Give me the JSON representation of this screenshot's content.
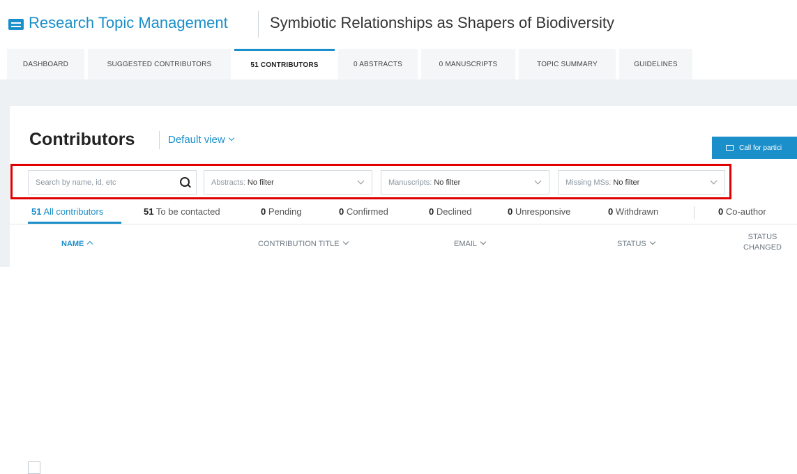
{
  "header": {
    "app_title": "Research Topic Management",
    "topic_title": "Symbiotic Relationships as Shapers of Biodiversity"
  },
  "tabs": [
    {
      "label": "DASHBOARD",
      "active": false
    },
    {
      "label": "SUGGESTED CONTRIBUTORS",
      "active": false
    },
    {
      "label": "51 CONTRIBUTORS",
      "active": true
    },
    {
      "label": "0 ABSTRACTS",
      "active": false
    },
    {
      "label": "0 MANUSCRIPTS",
      "active": false
    },
    {
      "label": "TOPIC SUMMARY",
      "active": false
    },
    {
      "label": "GUIDELINES",
      "active": false
    }
  ],
  "contributors": {
    "title": "Contributors",
    "view_select": "Default view",
    "call_button": "Call for partici"
  },
  "filters": {
    "search_placeholder": "Search by name, id, etc",
    "abstracts": {
      "label": "Abstracts:",
      "value": "No filter"
    },
    "manuscripts": {
      "label": "Manuscripts:",
      "value": "No filter"
    },
    "missing_ms": {
      "label": "Missing MSs:",
      "value": "No filter"
    }
  },
  "status_tabs": [
    {
      "count": "51",
      "label": "All contributors"
    },
    {
      "count": "51",
      "label": "To be contacted"
    },
    {
      "count": "0",
      "label": "Pending"
    },
    {
      "count": "0",
      "label": "Confirmed"
    },
    {
      "count": "0",
      "label": "Declined"
    },
    {
      "count": "0",
      "label": "Unresponsive"
    },
    {
      "count": "0",
      "label": "Withdrawn"
    },
    {
      "count": "0",
      "label": "Co-author"
    }
  ],
  "table": {
    "columns": {
      "name": "NAME",
      "contribution_title": "CONTRIBUTION TITLE",
      "email": "EMAIL",
      "status": "STATUS",
      "status_changed_line1": "STATUS",
      "status_changed_line2": "CHANGED"
    }
  },
  "colors": {
    "accent": "#1a8fc9",
    "highlight_frame": "#e00000"
  }
}
